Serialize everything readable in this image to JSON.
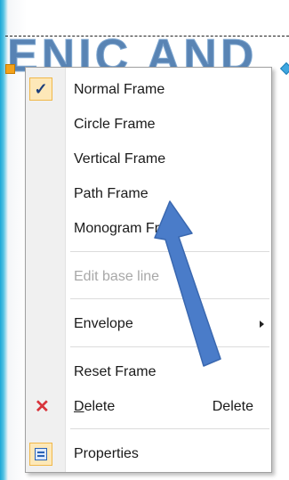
{
  "canvas": {
    "art_text": "ENIC AND"
  },
  "menu": {
    "items": [
      {
        "label": "Normal Frame",
        "checked": true
      },
      {
        "label": "Circle Frame"
      },
      {
        "label": "Vertical Frame"
      },
      {
        "label": "Path Frame"
      },
      {
        "label": "Monogram Frame"
      },
      {
        "label": "Edit base line",
        "disabled": true
      },
      {
        "label": "Envelope",
        "submenu": true
      },
      {
        "label": "Reset Frame"
      },
      {
        "label_first": "D",
        "label_rest": "elete",
        "shortcut": "Delete",
        "icon": "delete-x-icon"
      },
      {
        "label": "Properties",
        "icon": "properties-icon"
      }
    ],
    "check_glyph": "✓",
    "delete_glyph": "✕"
  },
  "colors": {
    "annotation_arrow": "#4a7cc9",
    "check_bg": "#fde8b8"
  }
}
